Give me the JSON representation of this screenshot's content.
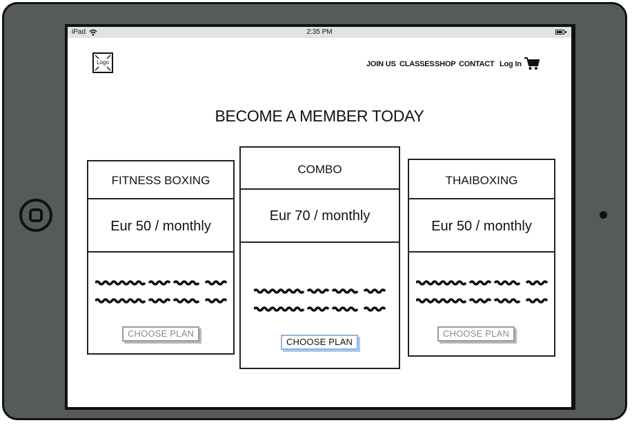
{
  "statusbar": {
    "carrier": "iPad",
    "time": "2:35 PM",
    "wifi_icon": "wifi-icon",
    "battery_icon": "battery-icon"
  },
  "header": {
    "logo_label": "Logo",
    "nav": [
      "JOIN US",
      "CLASSES",
      "SHOP",
      "CONTACT"
    ],
    "login_label": "Log In",
    "cart_icon": "shopping-cart-icon"
  },
  "main": {
    "title": "BECOME A MEMBER TODAY",
    "plans": [
      {
        "name": "FITNESS BOXING",
        "price": "Eur 50 / monthly",
        "button": "CHOOSE PLAN"
      },
      {
        "name": "COMBO",
        "price": "Eur 70 / monthly",
        "button": "CHOOSE PLAN"
      },
      {
        "name": "THAIBOXING",
        "price": "Eur 50 / monthly",
        "button": "CHOOSE PLAN"
      }
    ]
  },
  "colors": {
    "device": "#555a5b",
    "statusbar": "#dfe3e4",
    "primary_button_border": "#8fb4e0"
  }
}
